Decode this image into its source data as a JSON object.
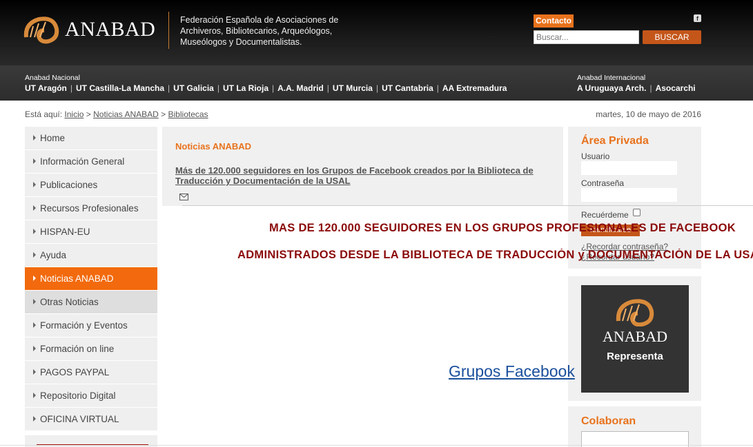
{
  "header": {
    "logo_text": "ANABAD",
    "org_name": "Federación Española de Asociaciones de\nArchiveros, Bibliotecarios, Arqueólogos,\nMuseólogos y Documentalistas.",
    "contact_label": "Contacto",
    "search_placeholder": "Buscar...",
    "search_button": "BUSCAR",
    "facebook_icon": "facebook-icon"
  },
  "nav": {
    "national_title": "Anabad Nacional",
    "national_links": [
      "UT Aragón",
      "UT Castilla-La Mancha",
      "UT Galicia",
      "UT La Rioja",
      "A.A. Madrid",
      "UT Murcia",
      "UT Cantabria",
      "AA Extremadura"
    ],
    "international_title": "Anabad Internacional",
    "international_links": [
      "A Uruguaya Arch.",
      "Asocarchi"
    ]
  },
  "breadcrumb": {
    "prefix": "Está aquí:",
    "items": [
      "Inicio",
      "Noticias ANABAD",
      "Bibliotecas"
    ],
    "separator": ">"
  },
  "date": "martes, 10 de mayo de 2016",
  "sidebar": {
    "items": [
      {
        "label": "Home"
      },
      {
        "label": "Información General"
      },
      {
        "label": "Publicaciones"
      },
      {
        "label": "Recursos Profesionales"
      },
      {
        "label": "HISPAN-EU"
      },
      {
        "label": "Ayuda"
      },
      {
        "label": "Noticias ANABAD",
        "state": "active"
      },
      {
        "label": "Otras Noticias",
        "state": "sub"
      },
      {
        "label": "Formación y Eventos"
      },
      {
        "label": "Formación on line"
      },
      {
        "label": "PAGOS PAYPAL"
      },
      {
        "label": "Repositorio Digital"
      },
      {
        "label": "OFICINA VIRTUAL"
      }
    ]
  },
  "main": {
    "title": "Noticias ANABAD",
    "article_link": "Más de 120.000 seguidores en los Grupos de Facebook creados por la Biblioteca de Traducción y Documentación de la USAL",
    "headline_line1": "MAS DE 120.000 SEGUIDORES EN LOS GRUPOS PROFESIONALES DE FACEBOOK",
    "headline_line2": "ADMINISTRADOS DESDE LA BIBLIOTECA DE TRADUCCIÓN y DOCUMENTACIÓN DE LA USAL",
    "fb_groups_link": "Grupos Facebook"
  },
  "private_area": {
    "title": "Área Privada",
    "user_label": "Usuario",
    "password_label": "Contraseña",
    "remember_label": "Recuérdeme",
    "login_button": "Identificarse",
    "forgot_password": "¿Recordar contraseña?",
    "forgot_user": "¿Recordar usuario?"
  },
  "represent": {
    "name": "ANABAD",
    "subtitle": "Representa"
  },
  "collaborators": {
    "title": "Colaboran"
  },
  "colors": {
    "accent": "#e8721c",
    "headline": "#8b0a0a",
    "link_blue": "#1a4f9c",
    "header_bg": "#111111"
  }
}
